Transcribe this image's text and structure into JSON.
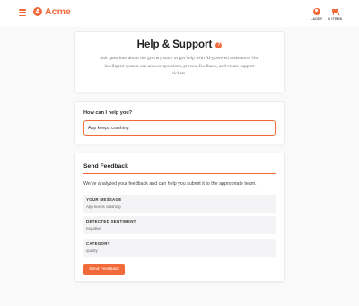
{
  "header": {
    "logo_mark": "A",
    "brand": "Acme",
    "actions": [
      {
        "label": "LADDY",
        "icon": "user-icon"
      },
      {
        "label": "0 ITEMS",
        "icon": "cart-icon"
      }
    ]
  },
  "hero": {
    "title": "Help & Support",
    "help_glyph": "?",
    "description": "Ask questions about the grocery store or get help with AI-powered assistance. Our intelligent system can answer questions, process feedback, and create support tickets."
  },
  "ask": {
    "label": "How can I help you?",
    "value": "App keeps crashing"
  },
  "feedback": {
    "title": "Send Feedback",
    "description": "We've analyzed your feedback and can help you submit it to the appropriate team.",
    "fields": [
      {
        "key": "YOUR MESSAGE",
        "value": "App keeps crashing"
      },
      {
        "key": "DETECTED SENTIMENT",
        "value": "negative"
      },
      {
        "key": "CATEGORY",
        "value": "quality"
      }
    ],
    "button": "Send Feedback"
  },
  "colors": {
    "accent": "#f26a3a",
    "background": "#f9f9fa",
    "card": "#ffffff",
    "field_background": "#f4f4f6"
  }
}
